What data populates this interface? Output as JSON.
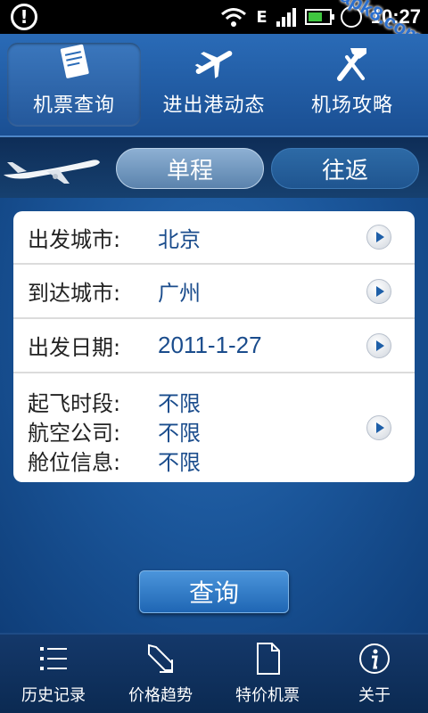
{
  "status_bar": {
    "time": "10:27",
    "network": "E",
    "icons": [
      "alert-icon",
      "wifi-icon",
      "signal-icon",
      "battery-icon",
      "alarm-icon"
    ],
    "watermark": "apk8.com"
  },
  "top_tabs": [
    {
      "label": "机票查询",
      "icon": "ticket-icon",
      "active": true
    },
    {
      "label": "进出港动态",
      "icon": "airplane-icon",
      "active": false
    },
    {
      "label": "机场攻略",
      "icon": "tools-icon",
      "active": false
    }
  ],
  "trip_type": {
    "one_way": "单程",
    "round_trip": "往返",
    "selected": "单程"
  },
  "form": {
    "departure_city_label": "出发城市:",
    "departure_city_value": "北京",
    "arrival_city_label": "到达城市:",
    "arrival_city_value": "广州",
    "departure_date_label": "出发日期:",
    "departure_date_value": "2011-1-27",
    "time_slot_label": "起飞时段:",
    "time_slot_value": "不限",
    "airline_label": "航空公司:",
    "airline_value": "不限",
    "cabin_label": "舱位信息:",
    "cabin_value": "不限"
  },
  "query_button": "查询",
  "bottom_nav": [
    {
      "label": "历史记录",
      "icon": "list-icon"
    },
    {
      "label": "价格趋势",
      "icon": "trend-arrow-icon"
    },
    {
      "label": "特价机票",
      "icon": "document-icon"
    },
    {
      "label": "关于",
      "icon": "info-icon"
    }
  ],
  "colors": {
    "background": "#0d3f7a",
    "top_bar": "#2a6bb7",
    "value_text": "#1a4c8c",
    "query_button": "#2f7cc8"
  }
}
